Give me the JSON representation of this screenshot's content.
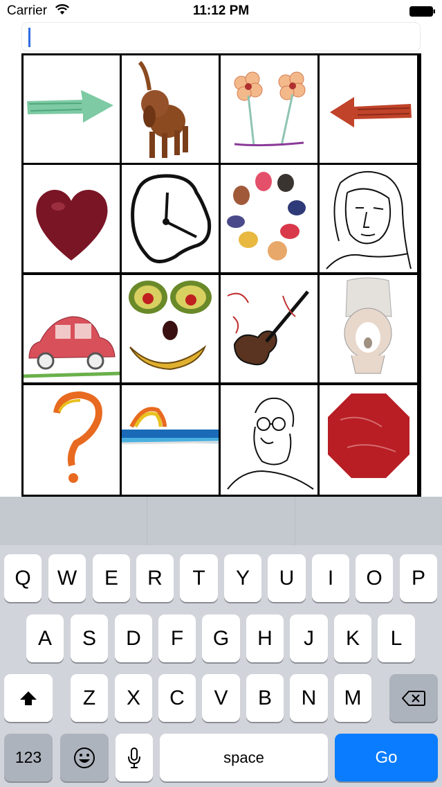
{
  "status_bar": {
    "carrier": "Carrier",
    "time": "11:12 PM"
  },
  "search": {
    "value": "",
    "placeholder": ""
  },
  "grid": {
    "cells": [
      {
        "name": "green-arrow-right-image"
      },
      {
        "name": "dog-image"
      },
      {
        "name": "flowers-image"
      },
      {
        "name": "red-arrow-left-image"
      },
      {
        "name": "heart-image"
      },
      {
        "name": "melting-clock-image"
      },
      {
        "name": "paint-blobs-image"
      },
      {
        "name": "woman-sketch-image"
      },
      {
        "name": "red-car-image"
      },
      {
        "name": "fruit-face-image"
      },
      {
        "name": "violin-image"
      },
      {
        "name": "toilet-image"
      },
      {
        "name": "question-mark-image"
      },
      {
        "name": "rainbow-sea-image"
      },
      {
        "name": "man-sketch-image"
      },
      {
        "name": "red-octagon-image"
      }
    ]
  },
  "keyboard": {
    "row1": [
      "Q",
      "W",
      "E",
      "R",
      "T",
      "Y",
      "U",
      "I",
      "O",
      "P"
    ],
    "row2": [
      "A",
      "S",
      "D",
      "F",
      "G",
      "H",
      "J",
      "K",
      "L"
    ],
    "row3": [
      "Z",
      "X",
      "C",
      "V",
      "B",
      "N",
      "M"
    ],
    "num_label": "123",
    "space_label": "space",
    "go_label": "Go",
    "accent_color": "#0a7cff"
  }
}
